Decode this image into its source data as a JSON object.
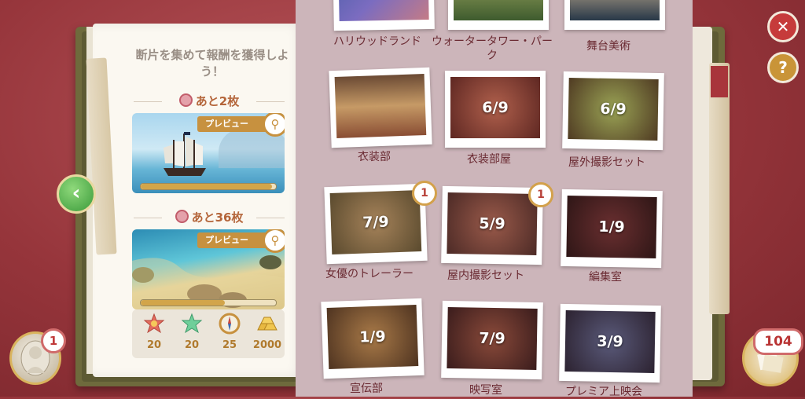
{
  "reward_panel": {
    "heading": "断片を集めて報酬を獲得しよう！",
    "reward_1": {
      "remaining": "あと2枚",
      "preview_label": "プレビュー",
      "progress": 0.97
    },
    "reward_2": {
      "remaining": "あと36枚",
      "preview_label": "プレビュー",
      "progress": 0.62
    },
    "items": [
      {
        "icon": "star-badge-icon",
        "value": "20"
      },
      {
        "icon": "green-star-icon",
        "value": "20"
      },
      {
        "icon": "compass-icon",
        "value": "25"
      },
      {
        "icon": "gold-bars-icon",
        "value": "2000"
      }
    ]
  },
  "locations": [
    {
      "label": "ハリウッドランド",
      "count": "",
      "badge": ""
    },
    {
      "label": "ウォータータワー・パーク",
      "count": "",
      "badge": ""
    },
    {
      "label": "舞台美術",
      "count": "",
      "badge": ""
    },
    {
      "label": "衣装部",
      "count": "",
      "badge": ""
    },
    {
      "label": "衣装部屋",
      "count": "6/9",
      "badge": ""
    },
    {
      "label": "屋外撮影セット",
      "count": "6/9",
      "badge": ""
    },
    {
      "label": "女優のトレーラー",
      "count": "7/9",
      "badge": "1"
    },
    {
      "label": "屋内撮影セット",
      "count": "5/9",
      "badge": "1"
    },
    {
      "label": "編集室",
      "count": "1/9",
      "badge": ""
    },
    {
      "label": "宣伝部",
      "count": "1/9",
      "badge": ""
    },
    {
      "label": "映写室",
      "count": "7/9",
      "badge": ""
    },
    {
      "label": "プレミア上映会",
      "count": "3/9",
      "badge": ""
    }
  ],
  "hud": {
    "cameo_badge": "1",
    "fragment_count": "104",
    "close_icon": "close-icon",
    "help_label": "?"
  },
  "colors": {
    "accent_gold": "#c7913f",
    "close_red": "#c63b3b",
    "back_green": "#3a9a3a"
  }
}
